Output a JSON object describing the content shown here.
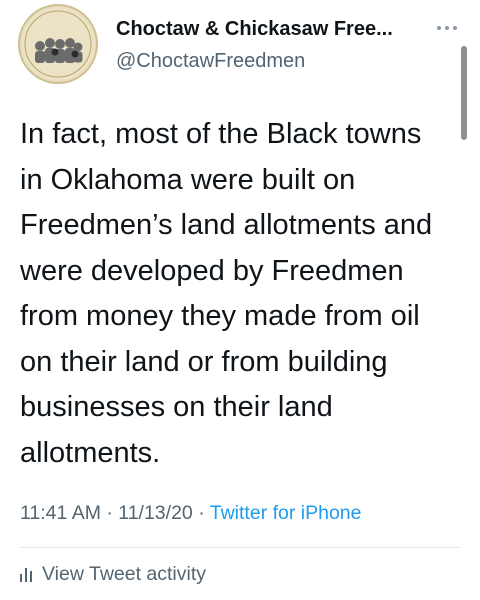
{
  "tweet": {
    "avatar": {
      "icon": "community-logo-avatar",
      "logo_lines": [
        "CHOCTAW &",
        "CHICKASAW",
        "FREEDMEN",
        "Community"
      ]
    },
    "display_name": "Choctaw & Chickasaw Free...",
    "handle": "@ChoctawFreedmen",
    "more_icon": "more-dots-icon",
    "body_lines": [
      "In fact, most of the Black towns",
      "in Oklahoma were built on",
      "Freedmen’s land allotments and",
      "were developed by Freedmen",
      "from money they made from oil",
      "on their land or from building",
      "businesses on their land",
      "allotments."
    ],
    "time": "11:41 AM",
    "date": "11/13/20",
    "separator": "·",
    "source": "Twitter for iPhone",
    "activity_icon": "bar-chart-icon",
    "activity_label": "View Tweet activity"
  },
  "colors": {
    "text": "#0f1419",
    "secondary": "#536471",
    "link": "#1d9bf0"
  }
}
